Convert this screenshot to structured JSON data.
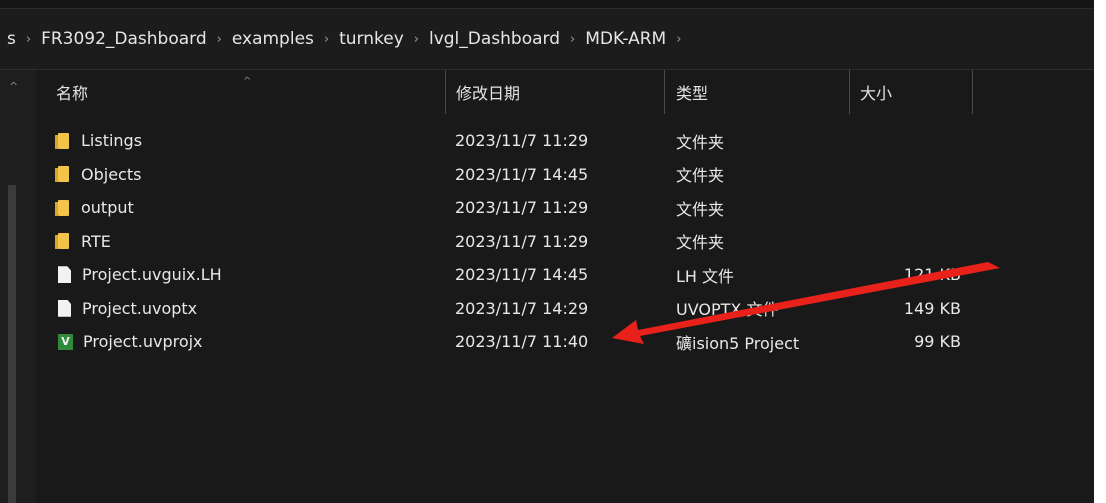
{
  "breadcrumb": [
    "s",
    "FR3092_Dashboard",
    "examples",
    "turnkey",
    "lvgl_Dashboard",
    "MDK-ARM"
  ],
  "columns": {
    "name": "名称",
    "date": "修改日期",
    "type": "类型",
    "size": "大小"
  },
  "files": [
    {
      "name": "Listings",
      "date": "2023/11/7 11:29",
      "type": "文件夹",
      "size": "",
      "icon": "folder-icon"
    },
    {
      "name": "Objects",
      "date": "2023/11/7 14:45",
      "type": "文件夹",
      "size": "",
      "icon": "folder-icon"
    },
    {
      "name": "output",
      "date": "2023/11/7 11:29",
      "type": "文件夹",
      "size": "",
      "icon": "folder-icon"
    },
    {
      "name": "RTE",
      "date": "2023/11/7 11:29",
      "type": "文件夹",
      "size": "",
      "icon": "folder-icon"
    },
    {
      "name": "Project.uvguix.LH",
      "date": "2023/11/7 14:45",
      "type": "LH 文件",
      "size": "121 KB",
      "icon": "file-icon"
    },
    {
      "name": "Project.uvoptx",
      "date": "2023/11/7 14:29",
      "type": "UVOPTX 文件",
      "size": "149 KB",
      "icon": "file-icon"
    },
    {
      "name": "Project.uvprojx",
      "date": "2023/11/7 11:40",
      "type": "礦ision5 Project",
      "size": "99 KB",
      "icon": "uvision-project-icon"
    }
  ],
  "annotation": {
    "color": "#e8221b"
  },
  "icons": {
    "chevron": "›",
    "sort_up": "^",
    "project_glyph": "V"
  }
}
